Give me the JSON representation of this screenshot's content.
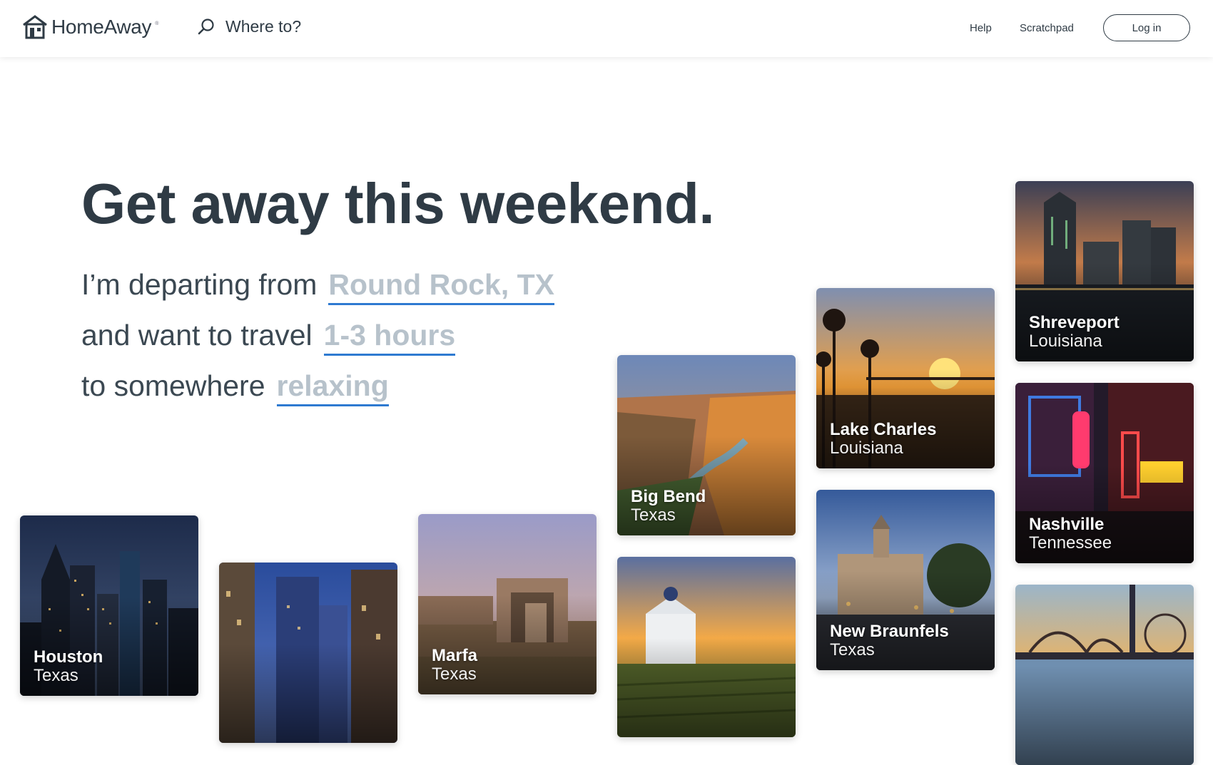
{
  "header": {
    "brand": "HomeAway",
    "brand_mark": "®",
    "search_label": "Where to?",
    "nav": {
      "help": "Help",
      "scratchpad": "Scratchpad",
      "login": "Log in"
    },
    "icons": {
      "logo": "house-icon",
      "search": "search-icon"
    }
  },
  "hero": {
    "title": "Get away this weekend.",
    "line1_prefix": "I’m departing from",
    "line1_value": "Round Rock, TX",
    "line2_prefix": "and want to travel",
    "line2_value": "1-3 hours",
    "line3_prefix": "to somewhere",
    "line3_value": "relaxing"
  },
  "destinations": [
    {
      "city": "Houston",
      "region": "Texas"
    },
    {
      "city": "",
      "region": ""
    },
    {
      "city": "Marfa",
      "region": "Texas"
    },
    {
      "city": "Big Bend",
      "region": "Texas"
    },
    {
      "city": "",
      "region": ""
    },
    {
      "city": "Lake Charles",
      "region": "Louisiana"
    },
    {
      "city": "New Braunfels",
      "region": "Texas"
    },
    {
      "city": "Shreveport",
      "region": "Louisiana"
    },
    {
      "city": "Nashville",
      "region": "Tennessee"
    },
    {
      "city": "",
      "region": ""
    }
  ],
  "colors": {
    "accent": "#2e7ad1",
    "text": "#2f3b45",
    "selection_text": "#b7c2cb"
  }
}
